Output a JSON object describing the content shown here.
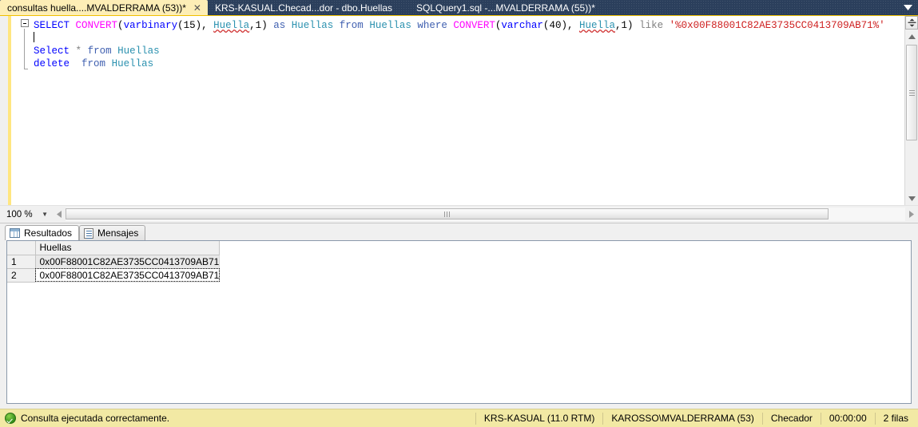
{
  "tabs": [
    {
      "label": "consultas huella....MVALDERRAMA (53))*",
      "active": true,
      "close": "✕"
    },
    {
      "label": "KRS-KASUAL.Checad...dor - dbo.Huellas",
      "active": false,
      "close": ""
    },
    {
      "label": "SQLQuery1.sql -...MVALDERRAMA (55))*",
      "active": false,
      "close": ""
    }
  ],
  "editor": {
    "line1": {
      "select": "SELECT",
      "convert1": "CONVERT",
      "open1": "(",
      "varbinary": "varbinary",
      "open2": "(",
      "num15": "15",
      "close2": ")",
      "comma1": ", ",
      "huella1": "Huella",
      "comma2": ",",
      "num1a": "1",
      "close1": ")",
      "as": "as",
      "huellas_alias": "Huellas",
      "from": "from",
      "huellas_tbl": "Huellas",
      "where": "where",
      "convert2": "CONVERT",
      "open3": "(",
      "varchar": "varchar",
      "open4": "(",
      "num40": "40",
      "close4": ")",
      "comma3": ", ",
      "huella2": "Huella",
      "comma4": ",",
      "num1b": "1",
      "close3": ")",
      "like": "like",
      "literal": "'%0x00F88001C82AE3735CC0413709AB71%'"
    },
    "line3": {
      "select": "Select",
      "star": "*",
      "from": "from",
      "table": "Huellas"
    },
    "line4": {
      "delete": "delete",
      "from": "from",
      "table": "Huellas"
    }
  },
  "zoombar": {
    "zoom_level": "100 %",
    "zoom_arrow": "▼",
    "left_arrow": "◀",
    "right_arrow": "▶"
  },
  "results": {
    "tabs": [
      {
        "label": "Resultados",
        "icon": "grid-icon",
        "active": true
      },
      {
        "label": "Mensajes",
        "icon": "message-icon",
        "active": false
      }
    ],
    "grid": {
      "row_header": "",
      "columns": [
        "Huellas"
      ],
      "rows": [
        {
          "num": "1",
          "values": [
            "0x00F88001C82AE3735CC0413709AB71"
          ]
        },
        {
          "num": "2",
          "values": [
            "0x00F88001C82AE3735CC0413709AB71"
          ]
        }
      ]
    }
  },
  "statusbar": {
    "message": "Consulta ejecutada correctamente.",
    "server": "KRS-KASUAL (11.0 RTM)",
    "user": "KAROSSO\\MVALDERRAMA (53)",
    "database": "Checador",
    "elapsed": "00:00:00",
    "rows": "2 filas"
  },
  "colors": {
    "tabbar_bg": "#2b3f5c",
    "active_tab_bg": "#fdeeb6",
    "status_bg": "#f2e9a4",
    "keyword_blue": "#0000ff",
    "function_pink": "#ff00ff",
    "identifier_teal": "#2b91af",
    "string_red": "#ce2020",
    "clause_kw": "#4060b0",
    "accent_yellow": "#f0c000"
  }
}
